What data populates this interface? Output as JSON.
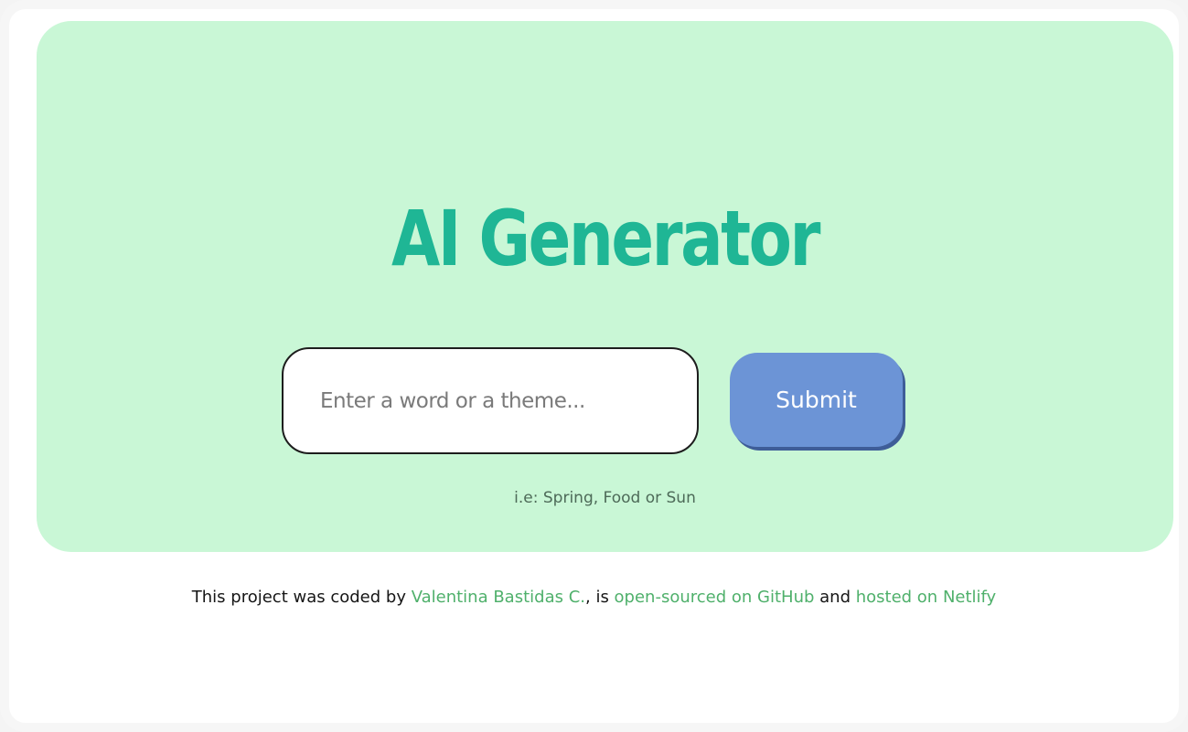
{
  "hero": {
    "title": "AI Generator",
    "input_placeholder": "Enter a word or a theme...",
    "submit_label": "Submit",
    "hint": "i.e: Spring, Food or Sun"
  },
  "footer": {
    "text_1": "This project was coded by ",
    "author_link": "Valentina Bastidas C.",
    "text_2": ", is ",
    "github_link": "open-sourced on GitHub",
    "text_3": " and ",
    "netlify_link": "hosted on Netlify"
  },
  "colors": {
    "hero_background": "#c9f7d6",
    "title": "#1fb695",
    "button": "#6c94d6",
    "link": "#4fb06b"
  }
}
